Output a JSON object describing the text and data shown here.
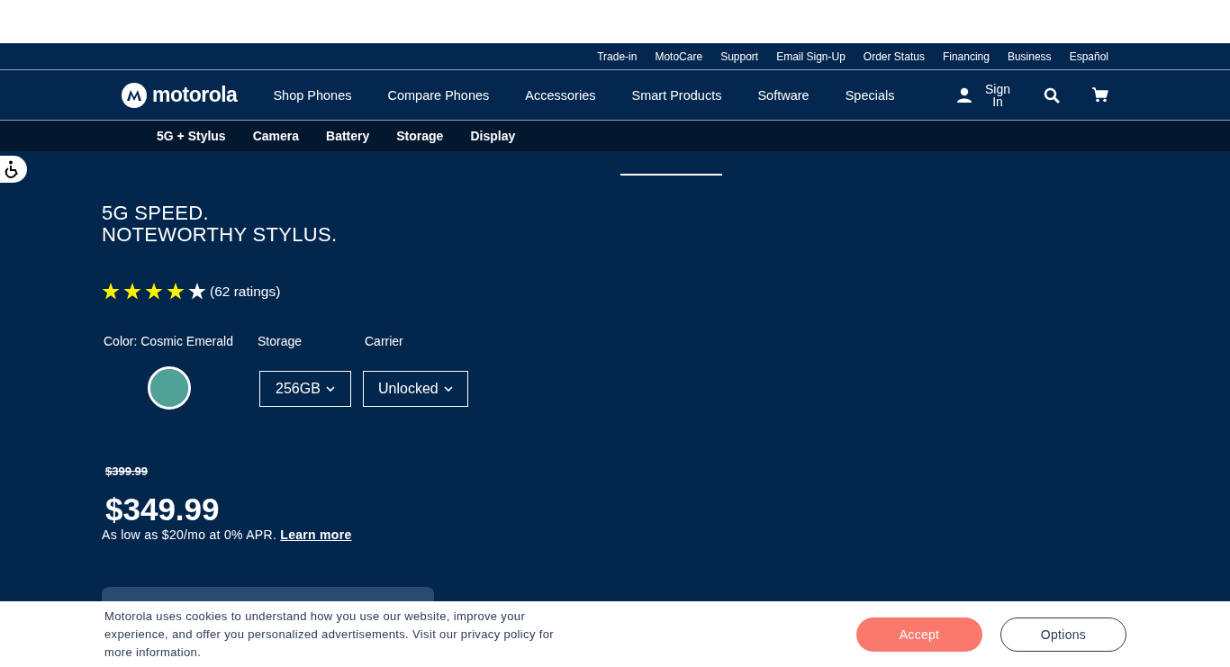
{
  "utility_links": [
    "Trade-in",
    "MotoCare",
    "Support",
    "Email Sign-Up",
    "Order Status",
    "Financing",
    "Business",
    "Español"
  ],
  "nav": {
    "logo": "motorola",
    "items": [
      "Shop Phones",
      "Compare Phones",
      "Accessories",
      "Smart Products",
      "Software",
      "Specials"
    ],
    "sign_in": "Sign In"
  },
  "subnav": [
    "5G + Stylus",
    "Camera",
    "Battery",
    "Storage",
    "Display"
  ],
  "hero": {
    "title": [
      "5G SPEED.",
      "NOTEWORTHY STYLUS."
    ],
    "rating": {
      "stars": 4,
      "text": "(62 ratings)"
    },
    "color": {
      "label": "Color: Cosmic Emerald",
      "swatches": [
        {
          "color": "#4fa295",
          "selected": true
        }
      ]
    },
    "storage": {
      "label": "Storage",
      "value": "256GB"
    },
    "carrier": {
      "label": "Carrier",
      "value": "Unlocked"
    },
    "price": {
      "original": "$399.99",
      "current": "$349.99",
      "financing": "As low as $20/mo at 0% APR.",
      "link": "Learn more"
    }
  },
  "cookie_banner": {
    "text": "Motorola uses cookies to understand how you use our website, improve your experience, and offer you personalized advertisements. Visit our privacy policy for more information.",
    "buttons": [
      "Accept",
      "Options"
    ]
  }
}
